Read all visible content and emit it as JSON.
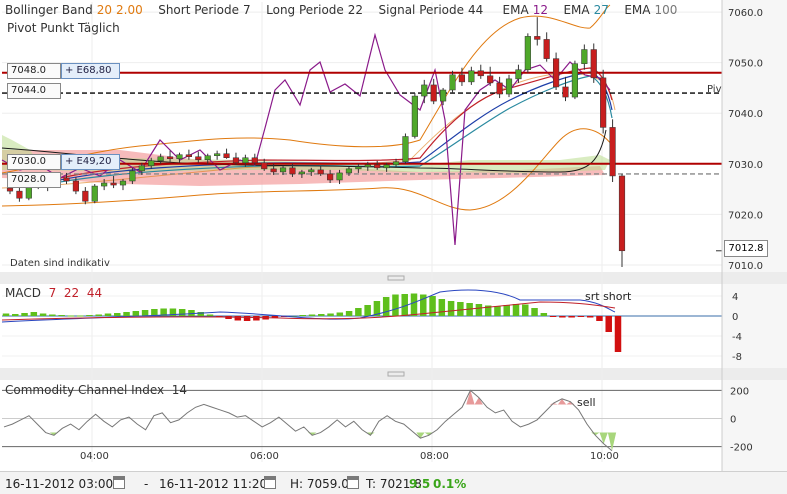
{
  "legend": {
    "bollinger_label": "Bollinger Band",
    "bollinger_p1": "20",
    "bollinger_p2": "2.00",
    "short_label": "Short Periode",
    "short_val": "7",
    "long_label": "Long Periode",
    "long_val": "22",
    "signal_label": "Signal Periode",
    "signal_val": "44",
    "ema1_label": "EMA",
    "ema1_val": "12",
    "ema2_label": "EMA",
    "ema2_val": "27",
    "ema3_label": "EMA",
    "ema3_val": "100",
    "pivot_title": "Pivot Punkt Täglich"
  },
  "notice": "Daten sind indikativ",
  "price_boxes": {
    "p7048": "7048.0",
    "e68": "+ E68,80",
    "p7044": "7044.0",
    "p7030": "7030.0",
    "e49": "+ E49,20",
    "p7028": "7028.0",
    "current": "7012.8",
    "pivot_label": "Piv"
  },
  "macd": {
    "label": "MACD",
    "v1": "7",
    "v2": "22",
    "v3": "44",
    "annotation": "srt short"
  },
  "cci": {
    "label": "Commodity Channel Index",
    "period": "14",
    "annotation": "sell"
  },
  "bottom": {
    "from": "16-11-2012 03:00",
    "dash": "-",
    "to": "16-11-2012 11:20",
    "high": "H: 7059.0",
    "low": "T: 7021.8",
    "change": "9.5",
    "pct": "0.1%"
  },
  "chart_data": {
    "type": "candlestick",
    "y_axis_ticks": [
      "7060.0",
      "7050.0",
      "7040.0",
      "7030.0",
      "7020.0",
      "7010.0"
    ],
    "ylim": [
      7009,
      7062
    ],
    "x_ticks": [
      "04:00",
      "06:00",
      "08:00",
      "10:00"
    ],
    "horizontal_levels": [
      {
        "label": "7048.0",
        "value": 7048.0,
        "color": "#b00000",
        "style": "solid"
      },
      {
        "label": "7044.0",
        "value": 7044.0,
        "color": "#000000",
        "style": "dashed"
      },
      {
        "label": "7030.0",
        "value": 7030.0,
        "color": "#b00000",
        "style": "solid"
      },
      {
        "label": "7028.0",
        "value": 7028.0,
        "color": "#888888",
        "style": "dashed"
      }
    ],
    "current_price": 7012.8,
    "candles": [
      {
        "o": 7025.2,
        "h": 7026.0,
        "l": 7024.0,
        "c": 7024.6
      },
      {
        "o": 7024.6,
        "h": 7025.8,
        "l": 7022.5,
        "c": 7023.2
      },
      {
        "o": 7023.2,
        "h": 7026.5,
        "l": 7022.8,
        "c": 7026.0
      },
      {
        "o": 7026.0,
        "h": 7027.4,
        "l": 7025.0,
        "c": 7025.4
      },
      {
        "o": 7025.4,
        "h": 7026.4,
        "l": 7024.6,
        "c": 7026.0
      },
      {
        "o": 7026.0,
        "h": 7027.8,
        "l": 7025.4,
        "c": 7027.2
      },
      {
        "o": 7027.2,
        "h": 7028.2,
        "l": 7026.0,
        "c": 7026.6
      },
      {
        "o": 7026.6,
        "h": 7027.4,
        "l": 7024.0,
        "c": 7024.6
      },
      {
        "o": 7024.6,
        "h": 7025.4,
        "l": 7022.0,
        "c": 7022.6
      },
      {
        "o": 7022.6,
        "h": 7026.0,
        "l": 7022.2,
        "c": 7025.6
      },
      {
        "o": 7025.6,
        "h": 7027.0,
        "l": 7024.8,
        "c": 7026.2
      },
      {
        "o": 7026.2,
        "h": 7027.6,
        "l": 7025.2,
        "c": 7025.8
      },
      {
        "o": 7025.8,
        "h": 7027.0,
        "l": 7024.8,
        "c": 7026.6
      },
      {
        "o": 7026.6,
        "h": 7029.2,
        "l": 7026.0,
        "c": 7028.6
      },
      {
        "o": 7028.6,
        "h": 7030.2,
        "l": 7027.8,
        "c": 7029.6
      },
      {
        "o": 7029.6,
        "h": 7031.2,
        "l": 7029.0,
        "c": 7030.6
      },
      {
        "o": 7030.6,
        "h": 7032.0,
        "l": 7030.0,
        "c": 7031.4
      },
      {
        "o": 7031.4,
        "h": 7032.6,
        "l": 7030.4,
        "c": 7031.0
      },
      {
        "o": 7031.0,
        "h": 7032.2,
        "l": 7030.2,
        "c": 7031.8
      },
      {
        "o": 7031.8,
        "h": 7032.8,
        "l": 7030.8,
        "c": 7031.4
      },
      {
        "o": 7031.4,
        "h": 7032.4,
        "l": 7030.2,
        "c": 7030.8
      },
      {
        "o": 7030.8,
        "h": 7032.0,
        "l": 7030.0,
        "c": 7031.6
      },
      {
        "o": 7031.6,
        "h": 7032.6,
        "l": 7030.8,
        "c": 7032.0
      },
      {
        "o": 7032.0,
        "h": 7033.0,
        "l": 7031.0,
        "c": 7031.2
      },
      {
        "o": 7031.2,
        "h": 7032.2,
        "l": 7029.8,
        "c": 7030.2
      },
      {
        "o": 7030.2,
        "h": 7031.8,
        "l": 7029.4,
        "c": 7031.2
      },
      {
        "o": 7031.2,
        "h": 7032.0,
        "l": 7029.8,
        "c": 7030.2
      },
      {
        "o": 7030.2,
        "h": 7031.0,
        "l": 7028.6,
        "c": 7029.0
      },
      {
        "o": 7029.0,
        "h": 7030.0,
        "l": 7027.8,
        "c": 7028.4
      },
      {
        "o": 7028.4,
        "h": 7029.6,
        "l": 7027.8,
        "c": 7029.2
      },
      {
        "o": 7029.2,
        "h": 7030.0,
        "l": 7027.4,
        "c": 7028.0
      },
      {
        "o": 7028.0,
        "h": 7028.8,
        "l": 7027.2,
        "c": 7028.4
      },
      {
        "o": 7028.4,
        "h": 7029.2,
        "l": 7027.6,
        "c": 7028.8
      },
      {
        "o": 7028.8,
        "h": 7029.6,
        "l": 7027.6,
        "c": 7028.0
      },
      {
        "o": 7028.0,
        "h": 7028.8,
        "l": 7026.2,
        "c": 7026.8
      },
      {
        "o": 7026.8,
        "h": 7028.8,
        "l": 7026.0,
        "c": 7028.2
      },
      {
        "o": 7028.2,
        "h": 7029.4,
        "l": 7027.6,
        "c": 7029.0
      },
      {
        "o": 7029.0,
        "h": 7030.0,
        "l": 7028.2,
        "c": 7029.4
      },
      {
        "o": 7029.4,
        "h": 7030.4,
        "l": 7028.6,
        "c": 7029.8
      },
      {
        "o": 7029.8,
        "h": 7030.6,
        "l": 7028.8,
        "c": 7029.2
      },
      {
        "o": 7029.2,
        "h": 7030.2,
        "l": 7028.4,
        "c": 7029.8
      },
      {
        "o": 7029.8,
        "h": 7031.0,
        "l": 7029.2,
        "c": 7030.4
      },
      {
        "o": 7030.4,
        "h": 7036.0,
        "l": 7030.0,
        "c": 7035.4
      },
      {
        "o": 7035.4,
        "h": 7044.0,
        "l": 7035.0,
        "c": 7043.4
      },
      {
        "o": 7043.4,
        "h": 7046.6,
        "l": 7042.0,
        "c": 7045.6
      },
      {
        "o": 7045.6,
        "h": 7046.8,
        "l": 7041.8,
        "c": 7042.4
      },
      {
        "o": 7042.4,
        "h": 7045.0,
        "l": 7041.6,
        "c": 7044.6
      },
      {
        "o": 7044.6,
        "h": 7048.4,
        "l": 7044.0,
        "c": 7047.6
      },
      {
        "o": 7047.6,
        "h": 7049.0,
        "l": 7045.4,
        "c": 7046.2
      },
      {
        "o": 7046.2,
        "h": 7049.2,
        "l": 7045.6,
        "c": 7048.4
      },
      {
        "o": 7048.4,
        "h": 7049.6,
        "l": 7046.8,
        "c": 7047.4
      },
      {
        "o": 7047.4,
        "h": 7049.2,
        "l": 7045.4,
        "c": 7046.0
      },
      {
        "o": 7046.0,
        "h": 7047.2,
        "l": 7043.0,
        "c": 7043.8
      },
      {
        "o": 7043.8,
        "h": 7047.6,
        "l": 7043.2,
        "c": 7046.8
      },
      {
        "o": 7046.8,
        "h": 7049.6,
        "l": 7046.0,
        "c": 7048.6
      },
      {
        "o": 7048.6,
        "h": 7055.8,
        "l": 7048.0,
        "c": 7055.2
      },
      {
        "o": 7055.2,
        "h": 7059.0,
        "l": 7053.4,
        "c": 7054.6
      },
      {
        "o": 7054.6,
        "h": 7056.0,
        "l": 7050.2,
        "c": 7050.8
      },
      {
        "o": 7050.8,
        "h": 7052.0,
        "l": 7044.6,
        "c": 7045.2
      },
      {
        "o": 7045.2,
        "h": 7047.2,
        "l": 7042.4,
        "c": 7043.2
      },
      {
        "o": 7043.2,
        "h": 7050.4,
        "l": 7042.8,
        "c": 7049.8
      },
      {
        "o": 7049.8,
        "h": 7053.6,
        "l": 7048.6,
        "c": 7052.6
      },
      {
        "o": 7052.6,
        "h": 7053.8,
        "l": 7046.0,
        "c": 7047.0
      },
      {
        "o": 7047.0,
        "h": 7048.6,
        "l": 7036.0,
        "c": 7037.2
      },
      {
        "o": 7037.2,
        "h": 7038.8,
        "l": 7026.4,
        "c": 7027.6
      },
      {
        "o": 7027.6,
        "h": 7028.0,
        "l": 7009.6,
        "c": 7012.8
      }
    ],
    "macd_axis_ticks": [
      "4",
      "0",
      "-4",
      "-8"
    ],
    "macd_ylim": [
      -10,
      6
    ],
    "macd_hist": [
      0.5,
      0.4,
      0.6,
      0.8,
      0.5,
      0.3,
      0.2,
      0.1,
      0.1,
      0.2,
      0.3,
      0.5,
      0.6,
      0.8,
      1.0,
      1.2,
      1.4,
      1.5,
      1.5,
      1.4,
      1.2,
      0.8,
      0.3,
      -0.2,
      -0.6,
      -0.9,
      -1.0,
      -0.9,
      -0.7,
      -0.4,
      -0.2,
      0.0,
      0.2,
      0.3,
      0.4,
      0.5,
      0.7,
      1.0,
      1.6,
      2.2,
      3.0,
      3.8,
      4.3,
      4.4,
      4.5,
      4.3,
      4.0,
      3.4,
      3.0,
      2.8,
      2.6,
      2.4,
      2.1,
      2.0,
      2.2,
      2.4,
      2.3,
      1.6,
      0.6,
      -0.2,
      -0.3,
      -0.3,
      -0.1,
      -0.3,
      -1.0,
      -3.2,
      -7.2
    ],
    "cci_axis_ticks": [
      "200",
      "0",
      "-200"
    ],
    "cci_ylim": [
      -260,
      260
    ],
    "cci": [
      -60,
      -40,
      -10,
      20,
      -40,
      -100,
      -120,
      -70,
      -40,
      -80,
      -20,
      30,
      -20,
      -60,
      -10,
      10,
      -40,
      -80,
      20,
      40,
      -30,
      -10,
      40,
      80,
      100,
      80,
      60,
      40,
      10,
      20,
      -20,
      -60,
      -30,
      10,
      -40,
      -90,
      -60,
      -120,
      -100,
      -60,
      -10,
      -60,
      -20,
      -80,
      -120,
      -20,
      20,
      -20,
      -40,
      -90,
      -140,
      -120,
      -80,
      -20,
      30,
      80,
      200,
      150,
      80,
      40,
      60,
      -20,
      -60,
      -40,
      -10,
      50,
      110,
      140,
      120,
      60,
      -40,
      -120,
      -180,
      -230
    ],
    "cci_note": "sell"
  }
}
